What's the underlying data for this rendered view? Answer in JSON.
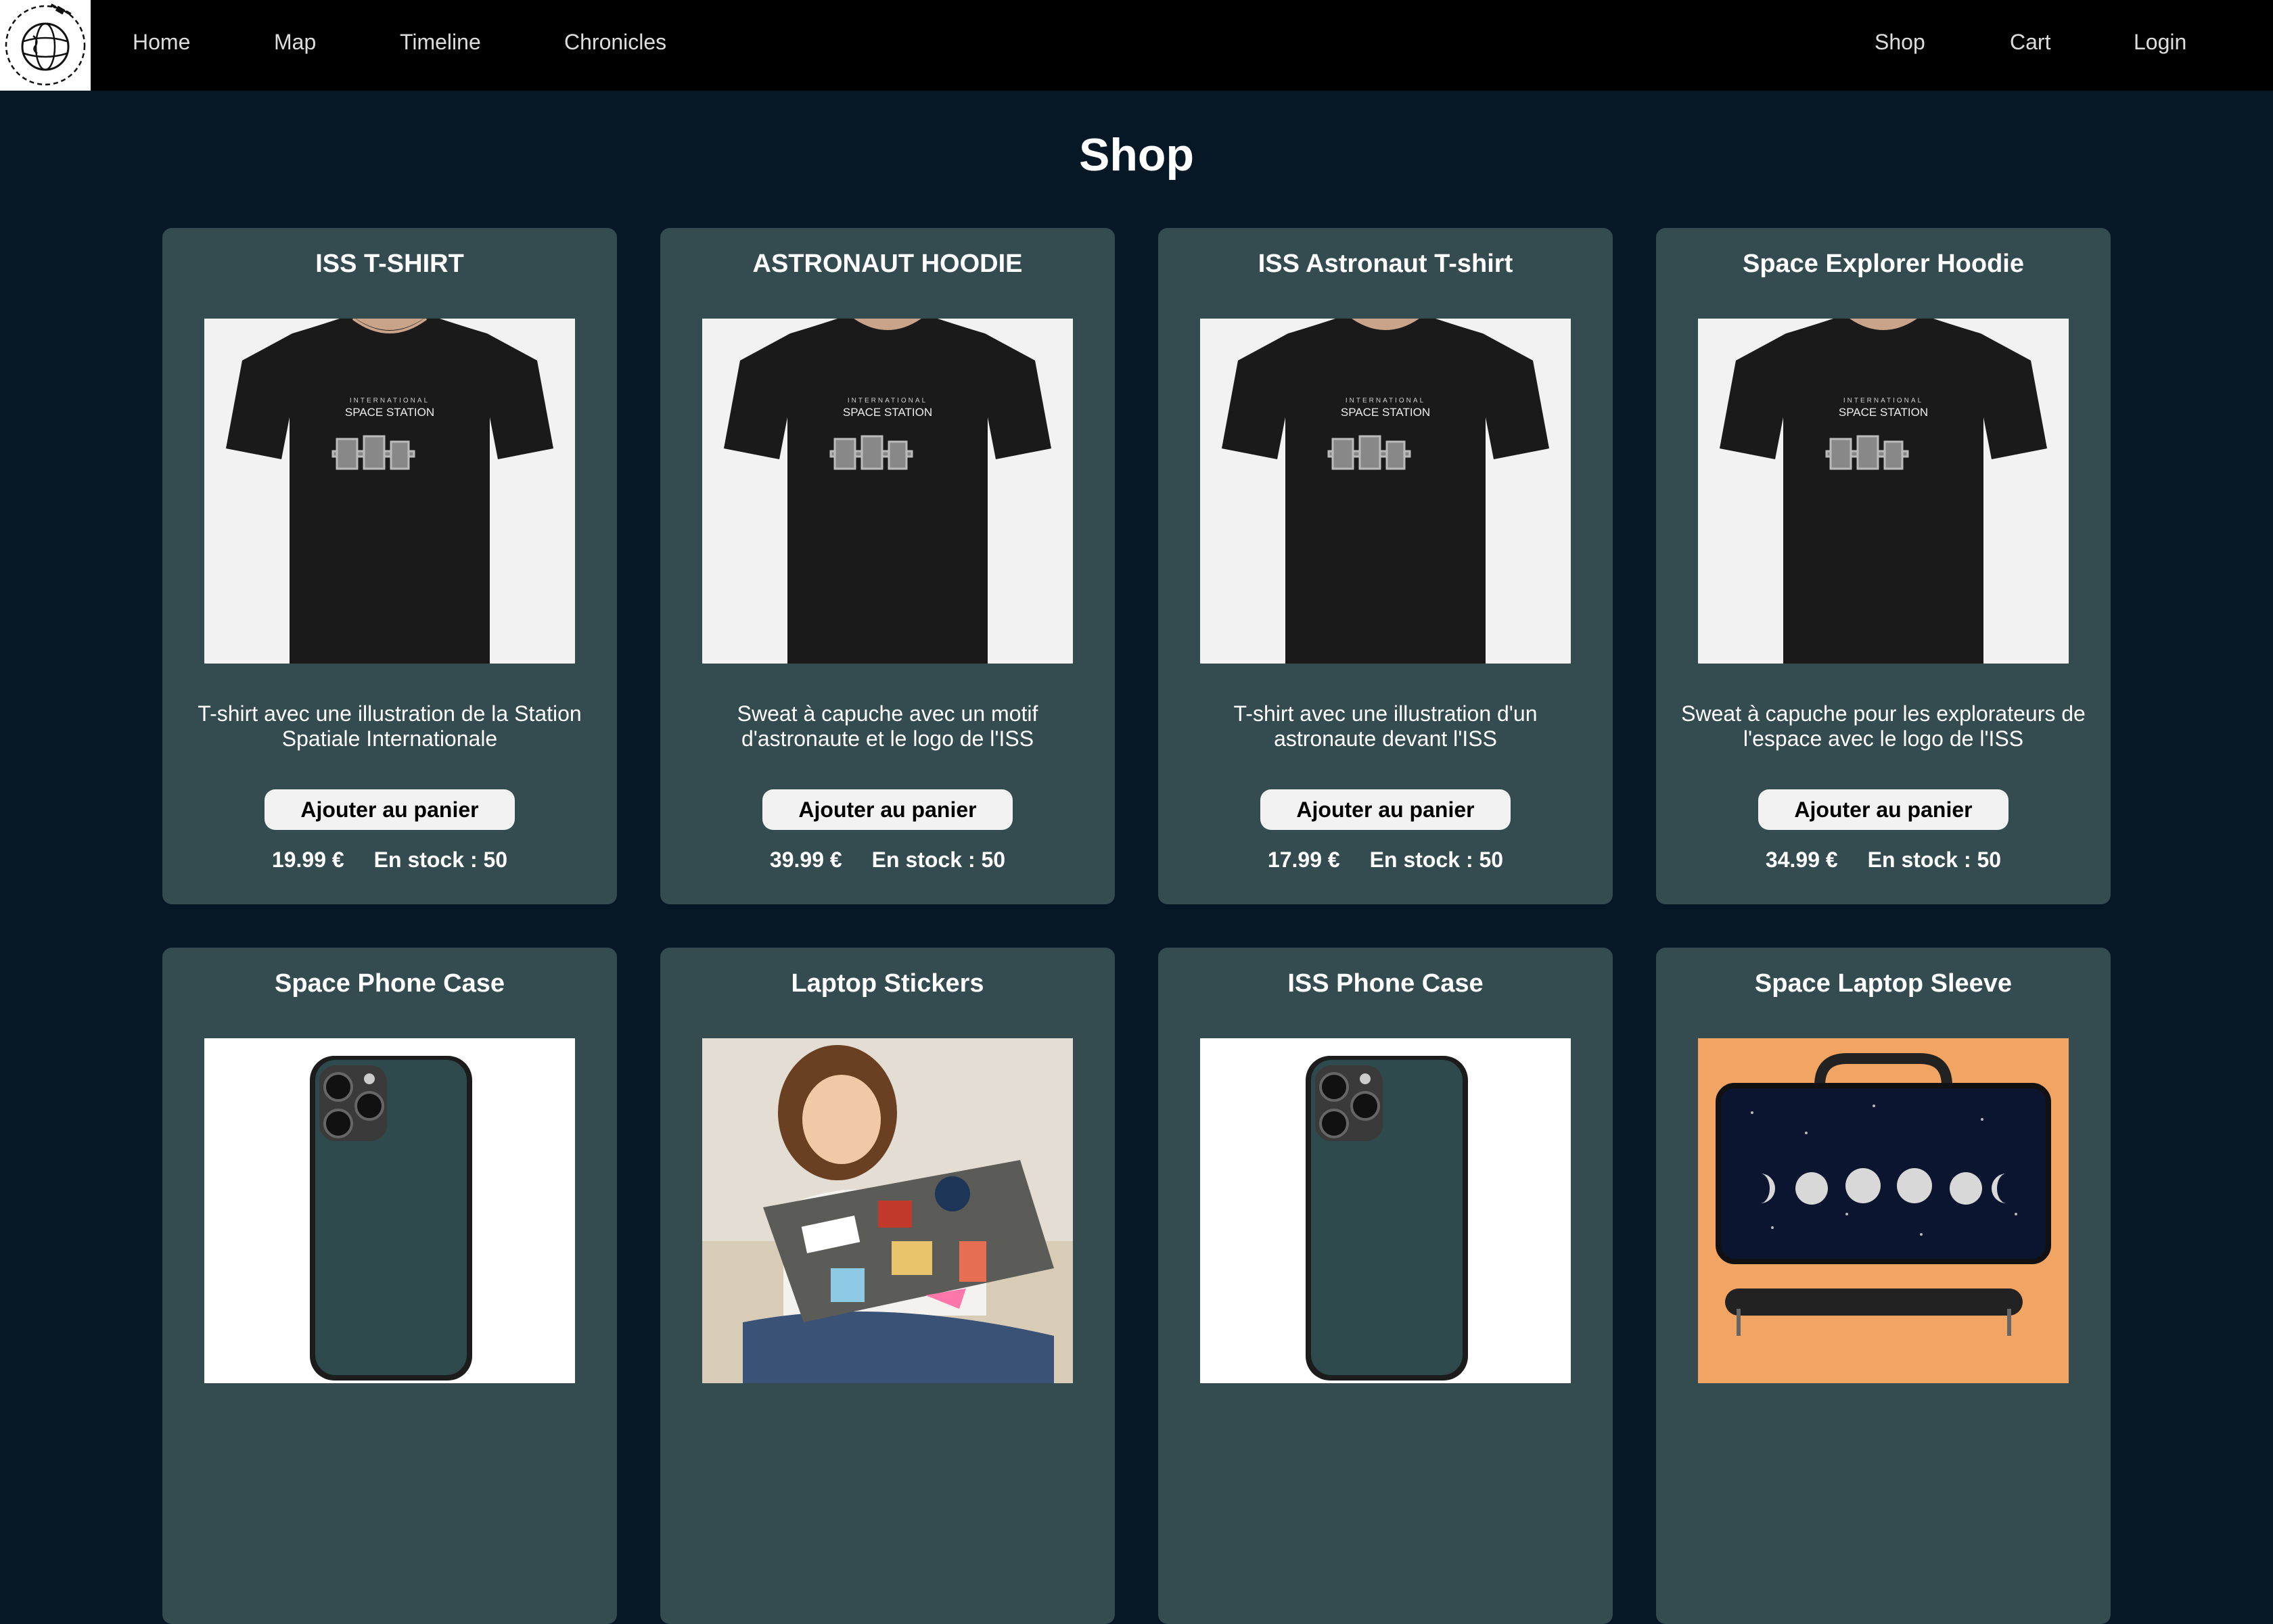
{
  "nav": {
    "logo_icon": "globe-satellite-icon",
    "left_links": [
      "Home",
      "Map",
      "Timeline",
      "Chronicles"
    ],
    "right_links": [
      "Shop",
      "Cart",
      "Login"
    ]
  },
  "page": {
    "title": "Shop"
  },
  "colors": {
    "background": "#061826",
    "nav_background": "#000000",
    "card_background": "#344b50",
    "button_background": "#f2f2f2"
  },
  "products": [
    {
      "name": "ISS T-SHIRT",
      "description": "T-shirt avec une illustration de la Station Spatiale Internationale",
      "button_label": "Ajouter au panier",
      "price": "19.99 €",
      "stock_label": "En stock :",
      "stock": "50",
      "image": "black-iss-tshirt"
    },
    {
      "name": "ASTRONAUT HOODIE",
      "description": "Sweat à capuche avec un motif d'astronaute et le logo de l'ISS",
      "button_label": "Ajouter au panier",
      "price": "39.99 €",
      "stock_label": "En stock :",
      "stock": "50",
      "image": "black-iss-tshirt"
    },
    {
      "name": "ISS Astronaut T-shirt",
      "description": "T-shirt avec une illustration d'un astronaute devant l'ISS",
      "button_label": "Ajouter au panier",
      "price": "17.99 €",
      "stock_label": "En stock :",
      "stock": "50",
      "image": "black-iss-tshirt"
    },
    {
      "name": "Space Explorer Hoodie",
      "description": "Sweat à capuche pour les explorateurs de l'espace avec le logo de l'ISS",
      "button_label": "Ajouter au panier",
      "price": "34.99 €",
      "stock_label": "En stock :",
      "stock": "50",
      "image": "black-iss-tshirt"
    },
    {
      "name": "Space Phone Case",
      "image": "dark-teal-phone-case"
    },
    {
      "name": "Laptop Stickers",
      "image": "girl-with-stickered-laptop"
    },
    {
      "name": "ISS Phone Case",
      "image": "dark-teal-phone-case"
    },
    {
      "name": "Space Laptop Sleeve",
      "image": "moon-phases-laptop-sleeve"
    }
  ]
}
